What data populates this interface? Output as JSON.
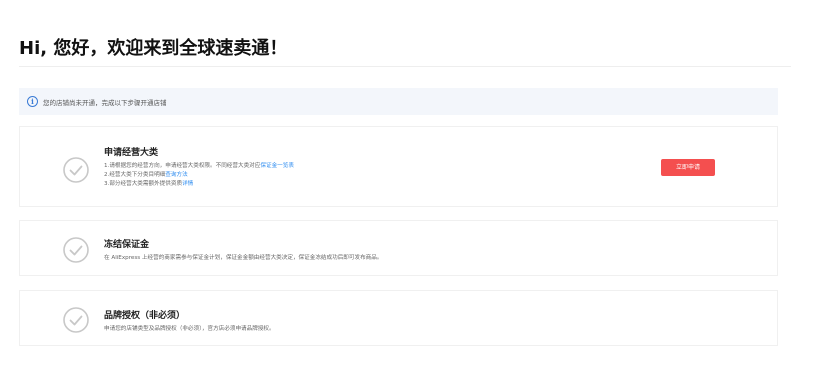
{
  "page": {
    "title": "Hi, 您好，欢迎来到全球速卖通！"
  },
  "notice": {
    "icon": "info-icon",
    "text": "您的店铺尚未开通，完成以下步骤开通店铺"
  },
  "steps": [
    {
      "title": "申请经营大类",
      "icon": "check-circle-icon",
      "lines": [
        {
          "text": "1.请根据您的经营方向，申请经营大类权限。不同经营大类对应",
          "link": "保证金一览表"
        },
        {
          "text": "2.经营大类下分类目明细",
          "link": "查询方法"
        },
        {
          "text": "3.部分经营大类需额外提供资质",
          "link": "详情"
        }
      ],
      "button_label": "立即申请"
    },
    {
      "title": "冻结保证金",
      "icon": "check-circle-icon",
      "lines": [
        {
          "text": "在 AliExpress 上经营的商家需参与保证金计划，保证金金额由经营大类决定，保证金冻结成功后即可发布商品。"
        }
      ]
    },
    {
      "title": "品牌授权（非必须）",
      "icon": "check-circle-icon",
      "lines": [
        {
          "text": "申请您的店铺类型及品牌授权（非必须），官方店必须申请品牌授权。"
        }
      ]
    }
  ],
  "colors": {
    "accent_red": "#f44f4f",
    "link_blue": "#2d8cf0",
    "check_gray": "#c8c8c8",
    "notice_bg": "#f3f6fb"
  }
}
